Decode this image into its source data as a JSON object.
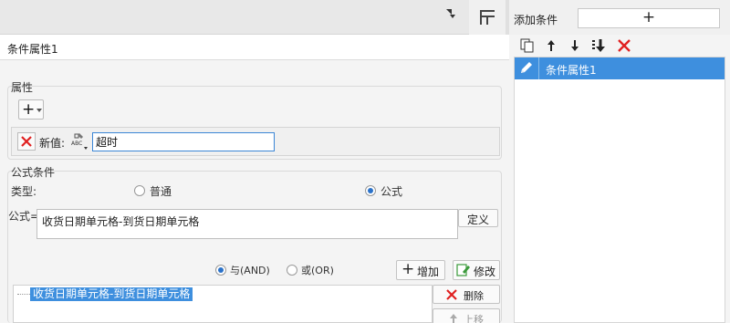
{
  "toolbar": {
    "dropdown_icon": "dropdown-arrow-icon",
    "layout_icon": "layout-grid-icon"
  },
  "left": {
    "title": "条件属性1",
    "attributes": {
      "section_label": "属性",
      "add_icon": "plus-icon",
      "row": {
        "label": "新值:",
        "value": "超时"
      }
    },
    "formula_condition": {
      "section_label": "公式条件",
      "type_label": "类型:",
      "type_options": [
        {
          "label": "普通",
          "selected": false
        },
        {
          "label": "公式",
          "selected": true
        }
      ],
      "formula_label": "公式=",
      "formula_text": "收货日期单元格-到货日期单元格",
      "define_button": "定义",
      "logic_options": [
        {
          "label": "与(AND)",
          "selected": true
        },
        {
          "label": "或(OR)",
          "selected": false
        }
      ],
      "add_button": "增加",
      "modify_button": "修改",
      "delete_button": "删除",
      "move_up_button": "上移",
      "conditions": [
        "收货日期单元格-到货日期单元格"
      ]
    }
  },
  "right": {
    "add_condition_label": "添加条件",
    "add_icon": "plus-icon",
    "tree_items": [
      {
        "label": "条件属性1",
        "selected": true
      }
    ]
  },
  "colors": {
    "selection": "#3e8fde",
    "delete_red": "#e02020",
    "input_focus": "#3b86d6"
  }
}
